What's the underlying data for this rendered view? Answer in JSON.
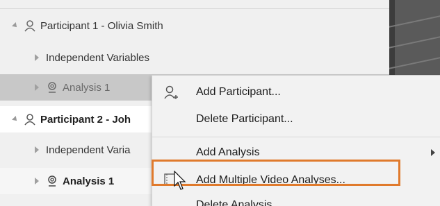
{
  "tree": {
    "participant1": {
      "label": "Participant 1 - Olivia Smith"
    },
    "independent_variables_1": {
      "label": "Independent Variables"
    },
    "analysis1_selected": {
      "label": "Analysis 1"
    },
    "participant2": {
      "label": "Participant 2 - Joh"
    },
    "independent_variables_2": {
      "label": "Independent Varia"
    },
    "analysis1_p2": {
      "label": "Analysis 1"
    }
  },
  "context_menu": {
    "items": [
      {
        "label": "Add Participant...",
        "icon": "add-person-icon"
      },
      {
        "label": "Delete Participant...",
        "icon": ""
      },
      {
        "label": "Add Analysis",
        "icon": "",
        "submenu": true
      },
      {
        "label": "Add Multiple Video Analyses...",
        "icon": "video-frames-icon",
        "highlighted": true
      },
      {
        "label": "Delete Analysis..."
      }
    ],
    "highlight_color": "#e07a2c"
  }
}
